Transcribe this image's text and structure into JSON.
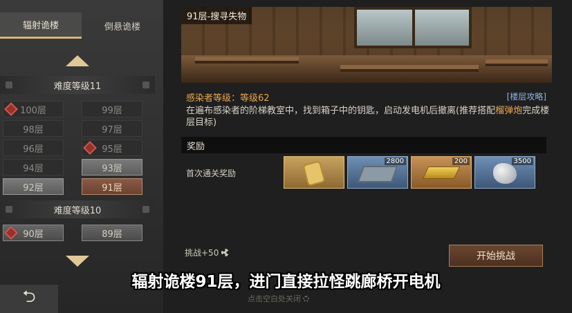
{
  "tabs": [
    {
      "label": "辐射诡楼",
      "active": true
    },
    {
      "label": "倒悬诡楼",
      "active": false
    }
  ],
  "difficulty_groups": [
    {
      "label": "难度等级11",
      "floors": [
        "100层",
        "99层",
        "98层",
        "97层",
        "96层",
        "95层",
        "94层",
        "93层",
        "92层",
        "91层"
      ]
    },
    {
      "label": "难度等级10",
      "floors": [
        "90层",
        "89层"
      ]
    }
  ],
  "stage": {
    "title": "91层-搜寻失物",
    "infected_level": "感染者等级：等级62",
    "guide_link": "[楼层攻略]",
    "description_part1": "在遍布感染者的阶梯教室中，找到箱子中的钥匙，启动发电机后撤离(推荐搭配",
    "description_highlight": "榴弹炮",
    "description_part2": "完成楼层目标)"
  },
  "rewards": {
    "header": "奖励",
    "first_clear_label": "首次通关奖励",
    "items": [
      {
        "icon": "dog-tag-icon",
        "qty": ""
      },
      {
        "icon": "cash-stack-icon",
        "qty": "2800"
      },
      {
        "icon": "gold-bar-icon",
        "qty": "200"
      },
      {
        "icon": "ore-icon",
        "qty": "3500"
      }
    ]
  },
  "challenge_cost": "挑战+50",
  "start_button": "开始挑战",
  "close_hint": "点击空白处关闭",
  "back_icon": "⮌",
  "subtitle": "辐射诡楼91层，进门直接拉怪跳廊桥开电机",
  "colors": {
    "accent_gold": "#d7b37a",
    "selected_floor": "#8a5a45",
    "infected_orange": "#e7a84f",
    "guide_blue": "#8fb5e6"
  }
}
